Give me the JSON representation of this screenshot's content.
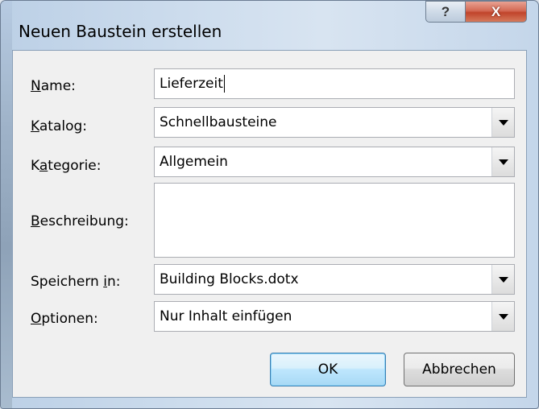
{
  "dialog": {
    "title": "Neuen Baustein erstellen",
    "help_label": "?",
    "close_label": "X"
  },
  "form": {
    "name": {
      "label_underlined": "N",
      "label_rest": "ame:",
      "value": "Lieferzeit"
    },
    "katalog": {
      "label_underlined": "K",
      "label_rest": "atalog:",
      "value": "Schnellbausteine"
    },
    "kategorie": {
      "label_pre": "K",
      "label_underlined": "a",
      "label_rest": "tegorie:",
      "value": "Allgemein"
    },
    "beschreibung": {
      "label_underlined": "B",
      "label_rest": "eschreibung:",
      "value": ""
    },
    "speichern": {
      "label_pre": "Speichern ",
      "label_underlined": "i",
      "label_rest": "n:",
      "value": "Building Blocks.dotx"
    },
    "optionen": {
      "label_underlined": "O",
      "label_rest": "ptionen:",
      "value": "Nur Inhalt einfügen"
    }
  },
  "buttons": {
    "ok": "OK",
    "cancel": "Abbrechen"
  }
}
